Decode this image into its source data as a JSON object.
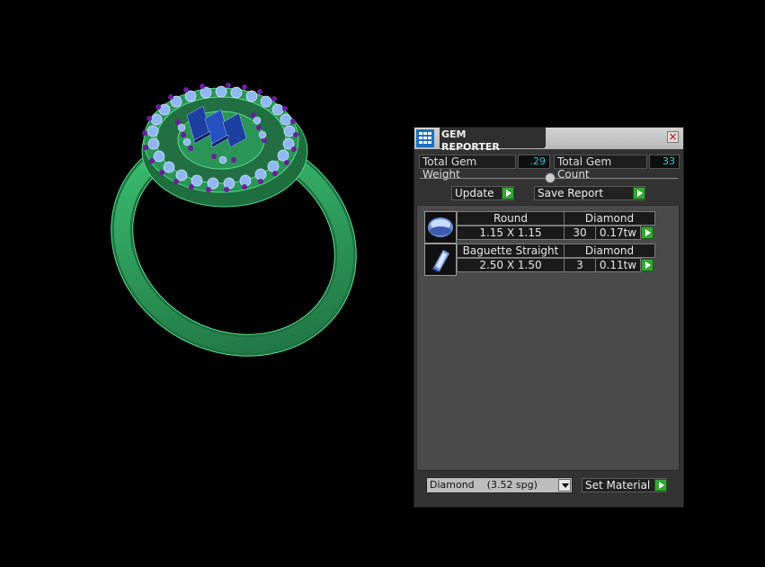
{
  "panel": {
    "title": "GEM REPORTER",
    "close_glyph": "×",
    "total_gem_weight_label": "Total Gem Weight",
    "total_gem_weight_value": ".29",
    "total_gem_count_label": "Total Gem Count",
    "total_gem_count_value": "33",
    "update_label": "Update",
    "save_report_label": "Save Report",
    "gems": [
      {
        "shape": "Round",
        "material": "Diamond",
        "size": "1.15 X 1.15",
        "count": "30",
        "weight": "0.17tw",
        "icon": "round-gem-icon"
      },
      {
        "shape": "Baguette Straight",
        "material": "Diamond",
        "size": "2.50 X 1.50",
        "count": "3",
        "weight": "0.11tw",
        "icon": "baguette-gem-icon"
      }
    ],
    "material_select": "Diamond    (3.52 spg)",
    "set_material_label": "Set Material"
  },
  "colors": {
    "ring_metal": "#2e9d5b",
    "round_gem": "#8fb8f0",
    "prong": "#6a1f9a",
    "baguette": "#1c3fa0",
    "value_text": "#39c6d6",
    "play_button": "#34a634"
  }
}
